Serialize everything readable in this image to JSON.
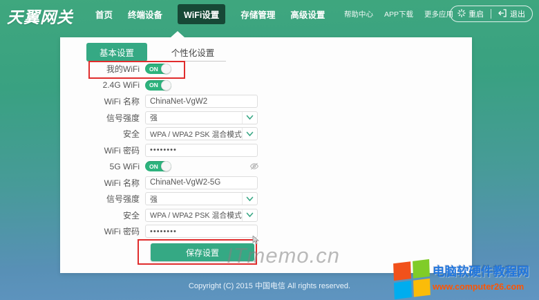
{
  "header": {
    "logo": "天翼网关",
    "nav": [
      {
        "label": "首页"
      },
      {
        "label": "终端设备"
      },
      {
        "label": "WiFi设置",
        "active": true
      },
      {
        "label": "存储管理"
      },
      {
        "label": "高级设置"
      }
    ],
    "links": [
      {
        "label": "帮助中心"
      },
      {
        "label": "APP下载"
      },
      {
        "label": "更多应用"
      }
    ],
    "restart_label": "重启",
    "logout_label": "退出"
  },
  "tabs": {
    "basic": "基本设置",
    "personal": "个性化设置"
  },
  "form": {
    "toggle_on": "ON",
    "my_wifi_label": "我的WiFi",
    "wifi24_label": "2.4G WiFi",
    "name24_label": "WiFi 名称",
    "name24_value": "ChinaNet-VgW2",
    "strength24_label": "信号强度",
    "strength24_value": "强",
    "security24_label": "安全",
    "security24_value": "WPA / WPA2 PSK 混合模式",
    "pwd24_label": "WiFi 密码",
    "pwd24_value": "••••••••",
    "wifi5_label": "5G WiFi",
    "name5_label": "WiFi 名称",
    "name5_value": "ChinaNet-VgW2-5G",
    "strength5_label": "信号强度",
    "strength5_value": "强",
    "security5_label": "安全",
    "security5_value": "WPA / WPA2 PSK 混合模式",
    "pwd5_label": "WiFi 密码",
    "pwd5_value": "••••••••",
    "save_label": "保存设置"
  },
  "watermarks": {
    "itmemo": "ITmemo.cn",
    "site_name": "电脑软硬件教程网",
    "site_url": "www.computer26.com"
  },
  "footer": {
    "copyright": "Copyright (C) 2015 中国电信 All rights reserved."
  },
  "colors": {
    "accent_green": "#35a984",
    "toggle_green": "#2db37d",
    "annotation_red": "#e02c2c",
    "bg_top_green": "#3fa77e",
    "bg_bottom_blue": "#6095c2"
  }
}
